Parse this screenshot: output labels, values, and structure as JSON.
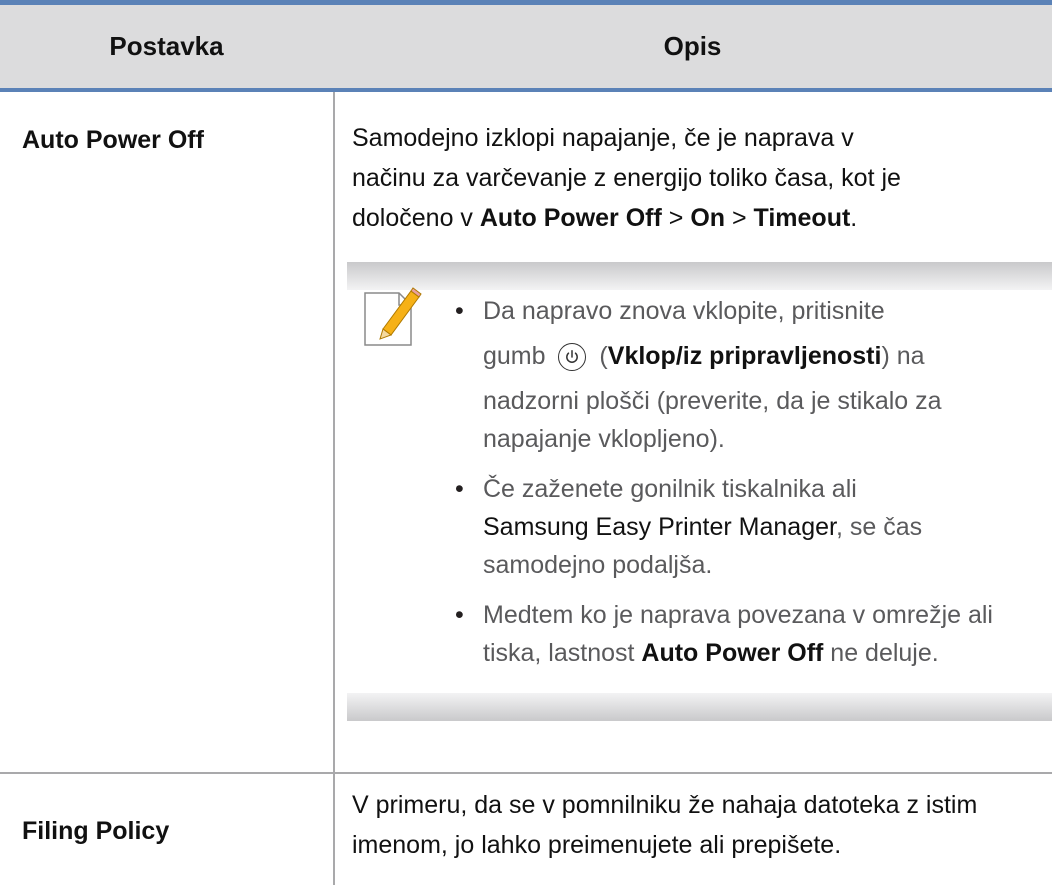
{
  "table": {
    "header": {
      "setting": "Postavka",
      "description": "Opis"
    },
    "rows": [
      {
        "setting": "Auto Power Off",
        "desc_line1": "Samodejno izklopi napajanje, če je naprava v",
        "desc_line2": "načinu za varčevanje z energijo toliko časa, kot je",
        "desc_line3_pre": "določeno v ",
        "desc_line3_b1": "Auto Power Off",
        "desc_line3_sep1": " > ",
        "desc_line3_b2": "On",
        "desc_line3_sep2": " > ",
        "desc_line3_b3": "Timeout",
        "desc_line3_end": ".",
        "note": {
          "icon": "note-pencil-icon",
          "bullets": [
            {
              "line1": "Da napravo znova vklopite, pritisnite",
              "pre": "gumb ",
              "button_icon": "power-icon",
              "open": " (",
              "bold": "Vklop/iz pripravljenosti",
              "close": ") na",
              "rest": "nadzorni plošči (preverite, da je stikalo za napajanje vklopljeno)."
            },
            {
              "pre": "Če zaženete gonilnik tiskalnika ali",
              "dark": "Samsung Easy Printer Manager",
              "post": ", se čas samodejno podaljša."
            },
            {
              "pre": "Medtem ko je naprava povezana v omrežje ali tiska, lastnost ",
              "bold": "Auto Power Off",
              "post": " ne deluje."
            }
          ]
        }
      },
      {
        "setting": "Filing Policy",
        "description": "V primeru, da se v pomnilniku že nahaja datoteka z istim imenom, jo lahko preimenujete ali prepišete."
      }
    ]
  }
}
